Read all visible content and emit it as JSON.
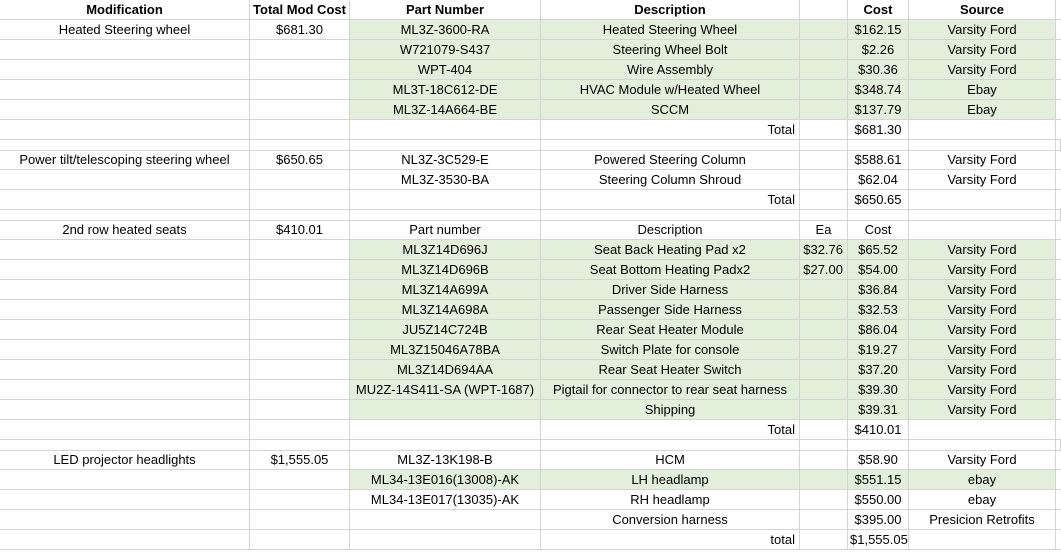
{
  "headers": [
    "Modification",
    "Total Mod Cost",
    "Part Number",
    "Description",
    "",
    "Cost",
    "Source"
  ],
  "sections": [
    {
      "modification": "Heated Steering wheel",
      "total_mod_cost": "$681.30",
      "rows": [
        {
          "part": "ML3Z-3600-RA",
          "desc": "Heated Steering Wheel",
          "ea": "",
          "cost": "$162.15",
          "source": "Varsity Ford",
          "green": true
        },
        {
          "part": "W721079-S437",
          "desc": "Steering Wheel Bolt",
          "ea": "",
          "cost": "$2.26",
          "source": "Varsity Ford",
          "green": true
        },
        {
          "part": "WPT-404",
          "desc": "Wire Assembly",
          "ea": "",
          "cost": "$30.36",
          "source": "Varsity Ford",
          "green": true
        },
        {
          "part": "ML3T-18C612-DE",
          "desc": "HVAC Module w/Heated Wheel",
          "ea": "",
          "cost": "$348.74",
          "source": "Ebay",
          "green": true
        },
        {
          "part": "ML3Z-14A664-BE",
          "desc": "SCCM",
          "ea": "",
          "cost": "$137.79",
          "source": "Ebay",
          "green": true
        }
      ],
      "total_label": "Total",
      "total_value": "$681.30"
    },
    {
      "modification": "Power tilt/telescoping steering wheel",
      "total_mod_cost": "$650.65",
      "rows": [
        {
          "part": "NL3Z-3C529-E",
          "desc": "Powered Steering Column",
          "ea": "",
          "cost": "$588.61",
          "source": "Varsity Ford",
          "green": false
        },
        {
          "part": "ML3Z-3530-BA",
          "desc": "Steering Column Shroud",
          "ea": "",
          "cost": "$62.04",
          "source": "Varsity Ford",
          "green": false
        }
      ],
      "total_label": "Total",
      "total_value": "$650.65"
    },
    {
      "modification": "2nd row heated seats",
      "total_mod_cost": "$410.01",
      "subheader": {
        "part": "Part number",
        "desc": "Description",
        "ea": "Ea",
        "cost": "Cost"
      },
      "rows": [
        {
          "part": "ML3Z14D696J",
          "desc": "Seat Back Heating Pad x2",
          "ea": "$32.76",
          "cost": "$65.52",
          "source": "Varsity Ford",
          "green": true
        },
        {
          "part": "ML3Z14D696B",
          "desc": "Seat Bottom Heating Padx2",
          "ea": "$27.00",
          "cost": "$54.00",
          "source": "Varsity Ford",
          "green": true
        },
        {
          "part": "ML3Z14A699A",
          "desc": "Driver Side Harness",
          "ea": "",
          "cost": "$36.84",
          "source": "Varsity Ford",
          "green": true
        },
        {
          "part": "ML3Z14A698A",
          "desc": "Passenger Side Harness",
          "ea": "",
          "cost": "$32.53",
          "source": "Varsity Ford",
          "green": true
        },
        {
          "part": "JU5Z14C724B",
          "desc": "Rear Seat Heater Module",
          "ea": "",
          "cost": "$86.04",
          "source": "Varsity Ford",
          "green": true
        },
        {
          "part": "ML3Z15046A78BA",
          "desc": "Switch Plate for console",
          "ea": "",
          "cost": "$19.27",
          "source": "Varsity Ford",
          "green": true
        },
        {
          "part": "ML3Z14D694AA",
          "desc": "Rear Seat Heater Switch",
          "ea": "",
          "cost": "$37.20",
          "source": "Varsity Ford",
          "green": true
        },
        {
          "part": "MU2Z-14S411-SA (WPT-1687)",
          "desc": "Pigtail for connector to rear seat harness",
          "ea": "",
          "cost": "$39.30",
          "source": "Varsity Ford",
          "green": true
        },
        {
          "part": "",
          "desc": "Shipping",
          "ea": "",
          "cost": "$39.31",
          "source": "Varsity Ford",
          "green": true
        }
      ],
      "total_label": "Total",
      "total_value": "$410.01"
    },
    {
      "modification": "LED projector headlights",
      "total_mod_cost": "$1,555.05",
      "rows": [
        {
          "part": "ML3Z-13K198-B",
          "desc": "HCM",
          "ea": "",
          "cost": "$58.90",
          "source": "Varsity Ford",
          "green": false
        },
        {
          "part": "ML34-13E016(13008)-AK",
          "desc": "LH headlamp",
          "ea": "",
          "cost": "$551.15",
          "source": "ebay",
          "green": true
        },
        {
          "part": "ML34-13E017(13035)-AK",
          "desc": "RH headlamp",
          "ea": "",
          "cost": "$550.00",
          "source": "ebay",
          "green": false
        },
        {
          "part": "",
          "desc": "Conversion harness",
          "ea": "",
          "cost": "$395.00",
          "source": "Presicion Retrofits",
          "green": false
        }
      ],
      "total_label": "total",
      "total_value": "$1,555.05"
    }
  ],
  "colors": {
    "highlight": "#e2efda",
    "grid": "#d4d4d4"
  }
}
